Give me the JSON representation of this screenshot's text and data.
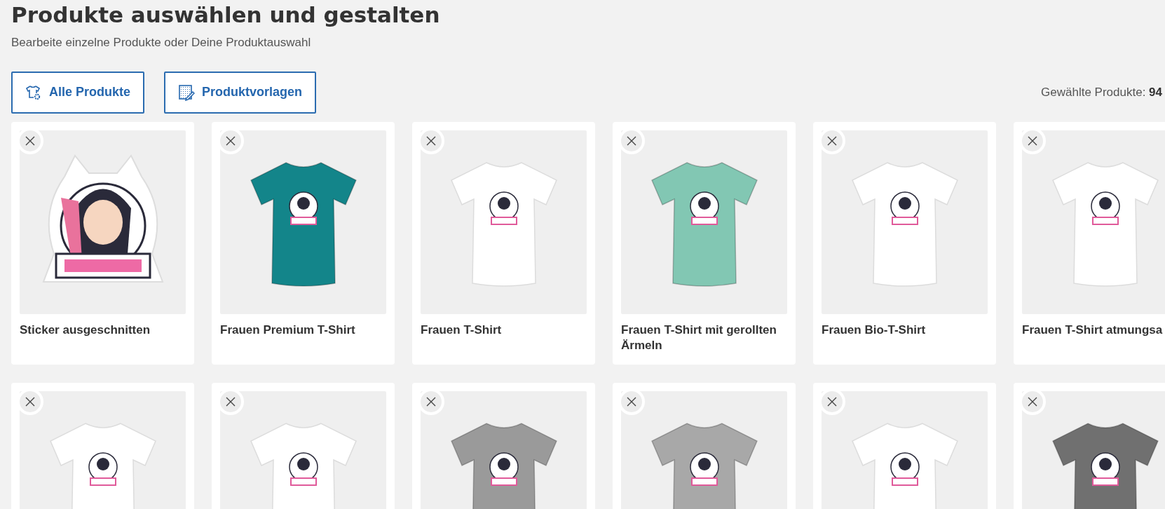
{
  "header": {
    "title": "Produkte auswählen und gestalten",
    "subtitle": "Bearbeite einzelne Produkte oder Deine Produktauswahl"
  },
  "buttons": [
    {
      "label": "Alle Produkte",
      "kind": "products"
    },
    {
      "label": "Produktvorlagen",
      "kind": "templates"
    }
  ],
  "selected_count": "Gewählte Produkte: **94**",
  "product_rows": [
    [
      {
        "kind": "sticker",
        "name": "Sticker ausgeschnitten"
      },
      {
        "kind": "tshirt",
        "color": "#13858a",
        "name": "Frauen Premium T-Shirt"
      },
      {
        "kind": "tshirt",
        "color": "#ffffff",
        "name": "Frauen T-Shirt"
      },
      {
        "kind": "tshirt",
        "color": "#82c7b3",
        "name": "Frauen T-Shirt mit gerollten Ärmeln"
      },
      {
        "kind": "tshirt",
        "color": "#ffffff",
        "name": "Frauen Bio-T-Shirt"
      },
      {
        "kind": "tshirt",
        "color": "#ffffff",
        "name": "Frauen T-Shirt atmungsa"
      }
    ],
    [
      {
        "kind": "tshirt",
        "color": "#ffffff"
      },
      {
        "kind": "tshirt",
        "color": "#ffffff"
      },
      {
        "kind": "tshirt",
        "color": "#9a9a9a"
      },
      {
        "kind": "tshirt",
        "color": "#a8a8a8"
      },
      {
        "kind": "tshirt",
        "color": "#ffffff"
      },
      {
        "kind": "tshirt",
        "color": "#707070"
      }
    ]
  ]
}
